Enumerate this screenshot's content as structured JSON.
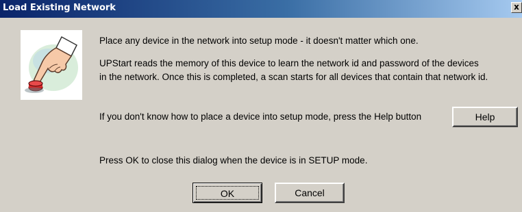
{
  "window": {
    "title": "Load Existing Network",
    "close_glyph": "x"
  },
  "icon": {
    "name": "pointing-hand-icon"
  },
  "messages": {
    "line1": "Place any device in the network into setup mode - it doesn't matter which one.",
    "line2": "UPStart reads the memory of this device to learn the network id and password of the devices",
    "line3": "in the network.  Once this is completed, a scan starts for all devices that contain that network id.",
    "line4": "If you don't know how to place a device into setup mode, press the Help button",
    "line5": "Press OK to close this dialog when the device is in SETUP mode."
  },
  "buttons": {
    "help": "Help",
    "ok": "OK",
    "cancel": "Cancel"
  }
}
